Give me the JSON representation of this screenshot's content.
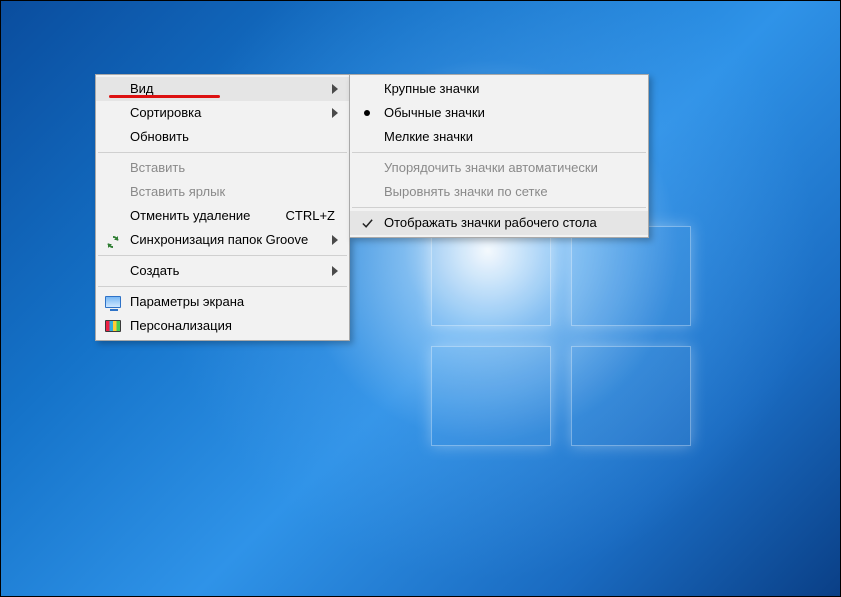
{
  "main_menu": {
    "view": {
      "label": "Вид"
    },
    "sort": {
      "label": "Сортировка"
    },
    "refresh": {
      "label": "Обновить"
    },
    "paste": {
      "label": "Вставить"
    },
    "paste_shortcut": {
      "label": "Вставить ярлык"
    },
    "undo_delete": {
      "label": "Отменить удаление",
      "shortcut": "CTRL+Z"
    },
    "groove_sync": {
      "label": "Синхронизация папок Groove"
    },
    "create": {
      "label": "Создать"
    },
    "display": {
      "label": "Параметры экрана"
    },
    "personalize": {
      "label": "Персонализация"
    }
  },
  "sub_menu": {
    "large_icons": {
      "label": "Крупные значки"
    },
    "medium_icons": {
      "label": "Обычные значки"
    },
    "small_icons": {
      "label": "Мелкие значки"
    },
    "auto_arrange": {
      "label": "Упорядочить значки автоматически"
    },
    "align_grid": {
      "label": "Выровнять значки по сетке"
    },
    "show_icons": {
      "label": "Отображать значки рабочего стола"
    }
  }
}
